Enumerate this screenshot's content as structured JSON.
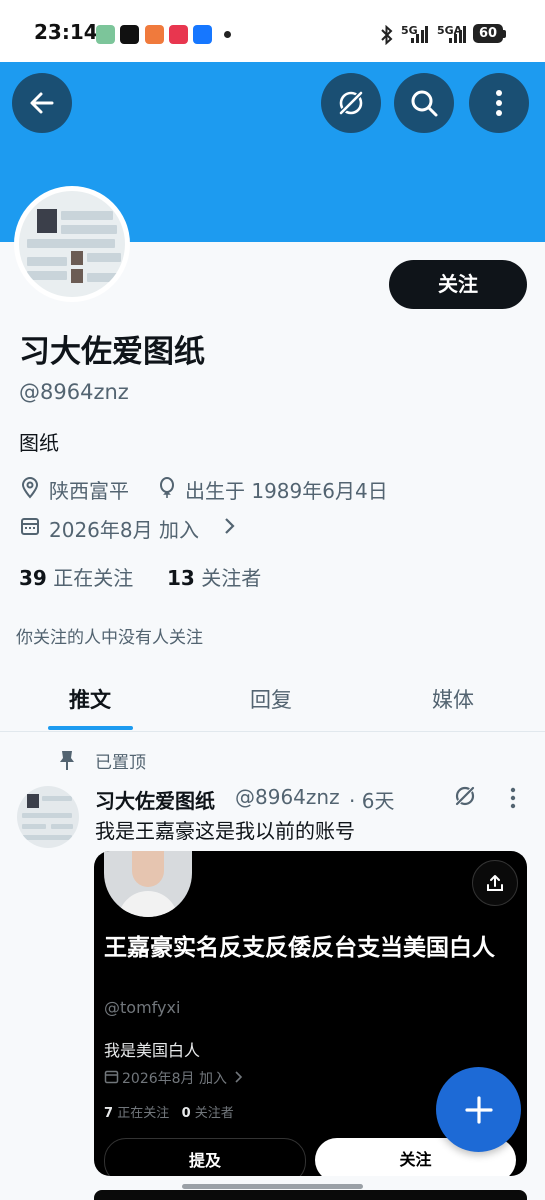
{
  "status_bar": {
    "time": "23:14",
    "network_1": "5G",
    "network_2": "5GA",
    "battery": "60"
  },
  "profile": {
    "display_name": "习大佐爱图纸",
    "handle": "@8964znz",
    "bio": "图纸",
    "location": "陕西富平",
    "birthday": "出生于 1989年6月4日",
    "joined": "2026年8月 加入",
    "following_count": "39",
    "following_label": "正在关注",
    "followers_count": "13",
    "followers_label": "关注者",
    "followers_you_know": "你关注的人中没有人关注",
    "follow_button": "关注"
  },
  "tabs": [
    {
      "label": "推文",
      "active": true
    },
    {
      "label": "回复",
      "active": false
    },
    {
      "label": "媒体",
      "active": false
    }
  ],
  "pinned_tweet": {
    "pinned_label": "已置顶",
    "author_name": "习大佐爱图纸",
    "author_handle": "@8964znz",
    "time": "· 6天",
    "text": "我是王嘉豪这是我以前的账号",
    "embedded_profile": {
      "name": "王嘉豪实名反支反倭反台支当美国白人",
      "handle": "@tomfyxi",
      "bio": "我是美国白人",
      "joined": "2026年8月 加入",
      "following_count": "7",
      "following_label": "正在关注",
      "followers_count": "0",
      "followers_label": "关注者",
      "mention_button": "提及",
      "follow_button": "关注"
    }
  },
  "icons": {
    "back": "back-arrow-icon",
    "grok": "grok-icon",
    "search": "search-icon",
    "more": "more-vertical-icon",
    "location": "location-pin-icon",
    "birthday": "balloon-icon",
    "calendar": "calendar-icon",
    "pin": "pin-icon",
    "upload": "share-upload-icon",
    "compose": "plus-icon"
  },
  "colors": {
    "banner": "#1d9bf0",
    "accent": "#1d9bf0",
    "fab": "#1d6ad6"
  }
}
